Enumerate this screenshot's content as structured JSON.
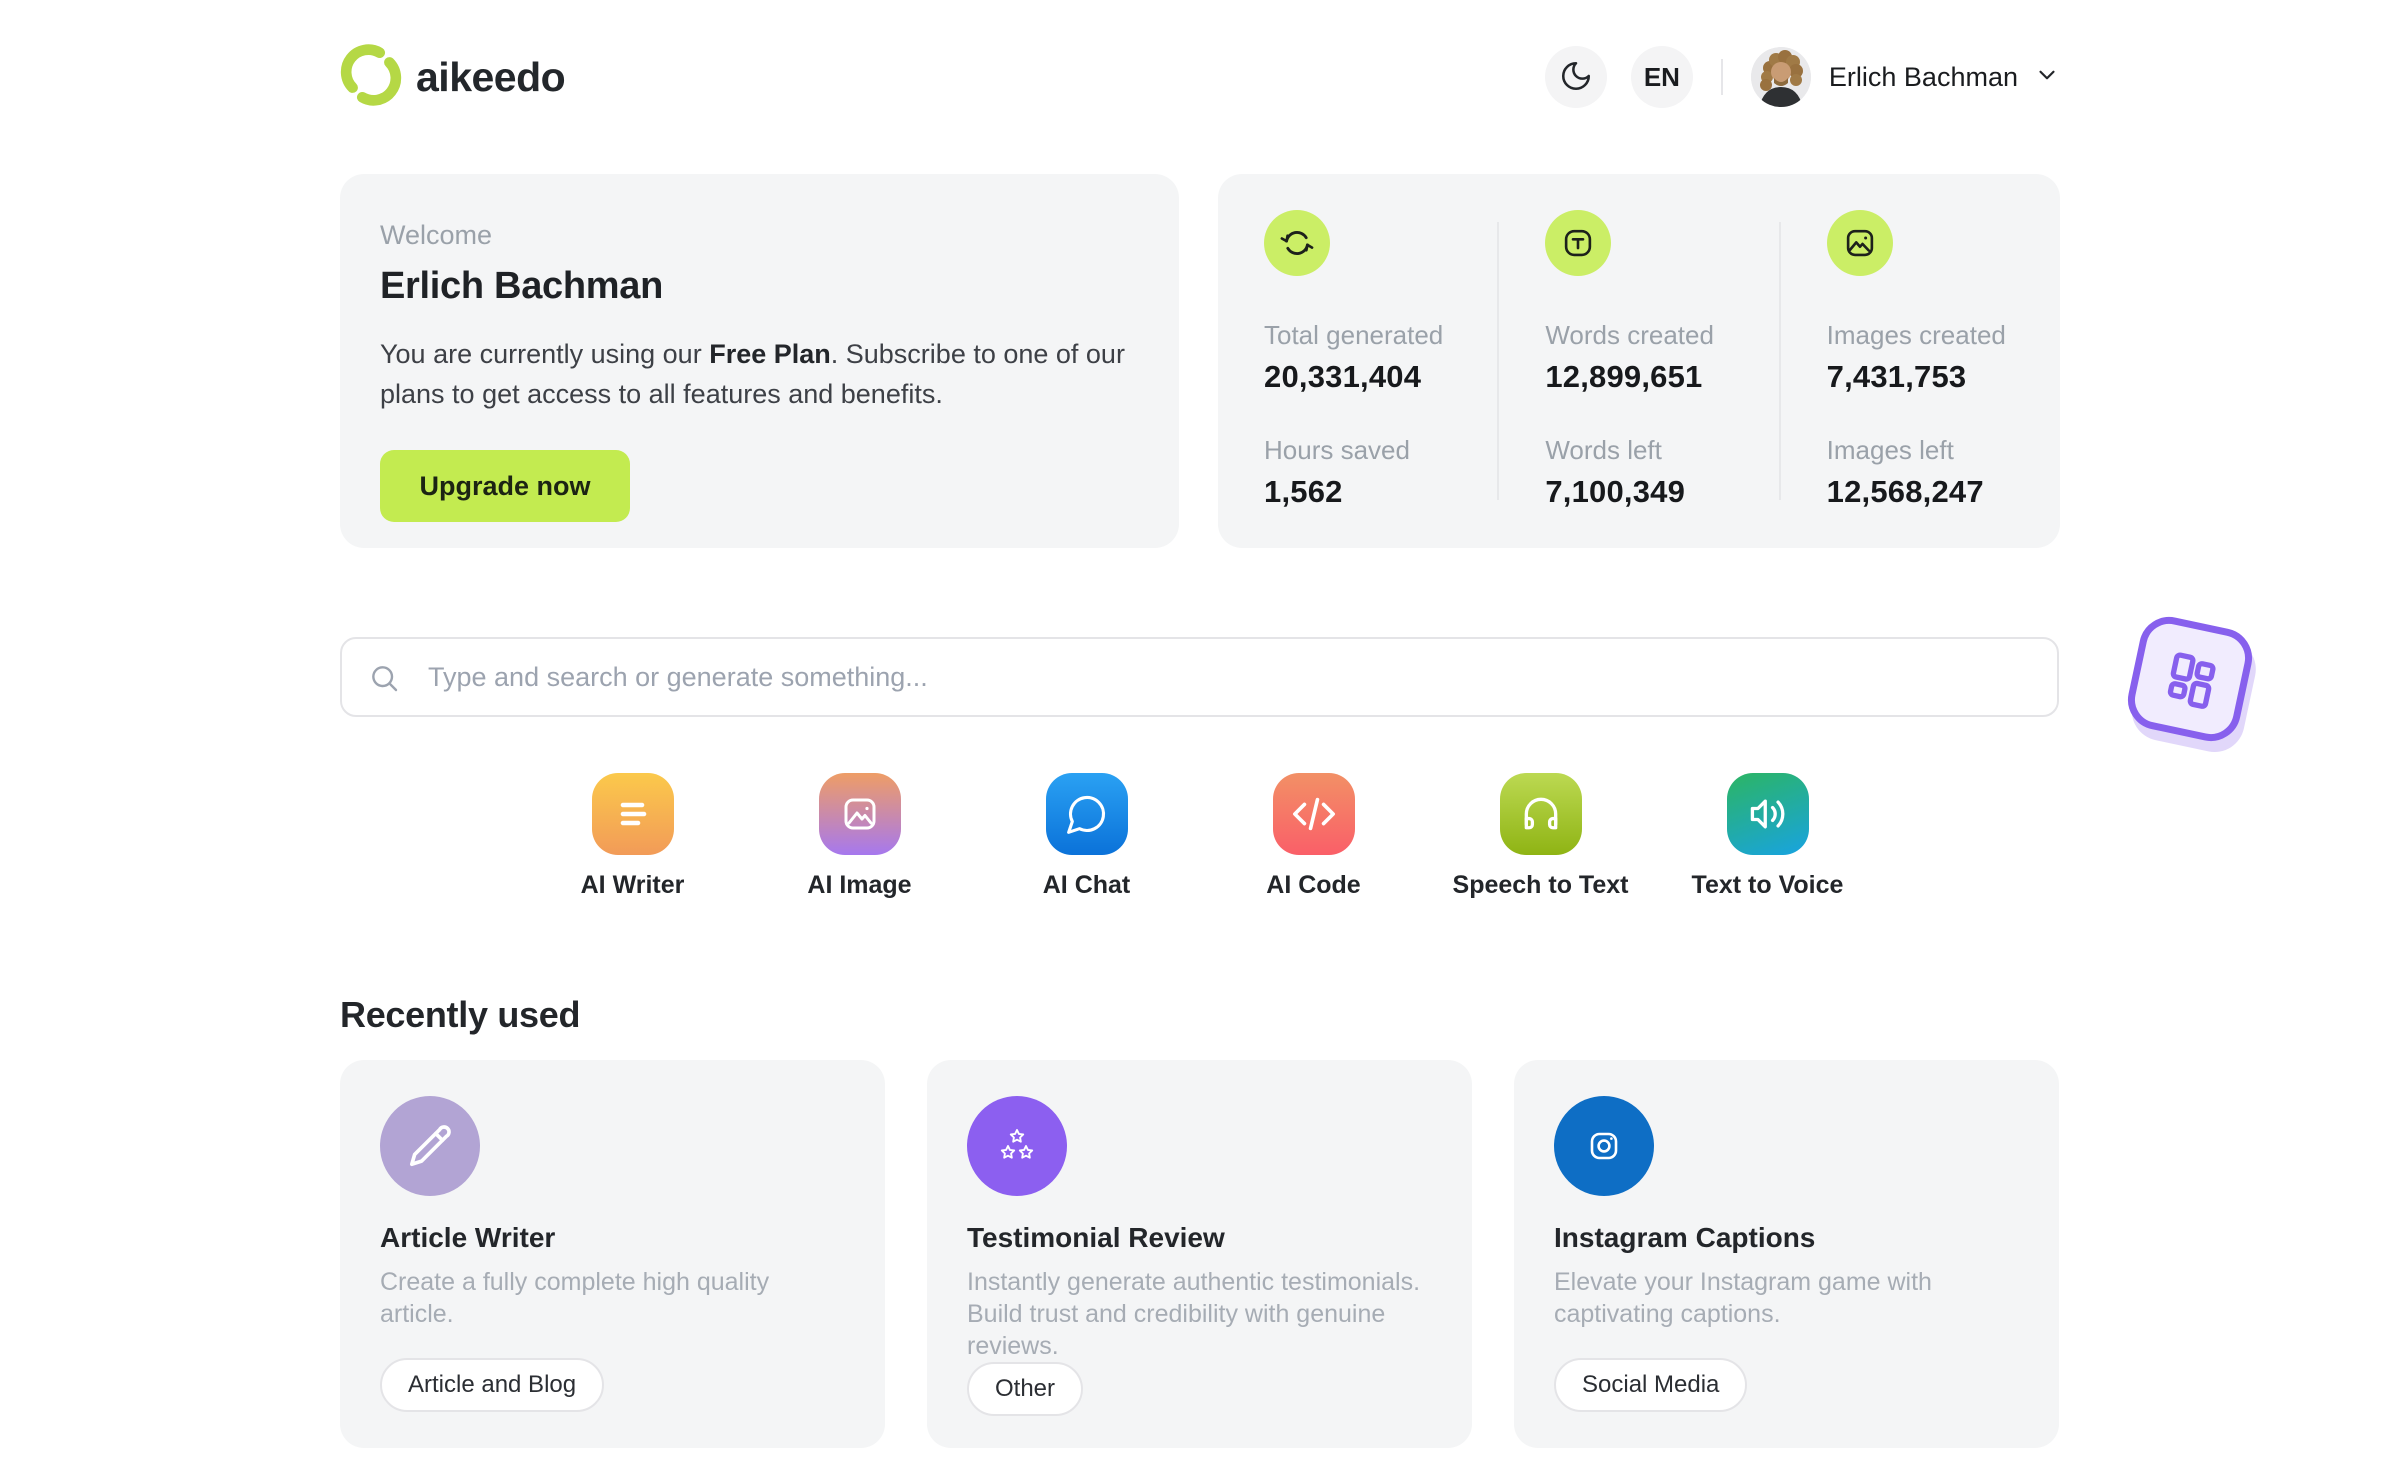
{
  "brand": {
    "name": "aikeedo"
  },
  "header": {
    "language": "EN",
    "user_name": "Erlich Bachman"
  },
  "welcome": {
    "eyebrow": "Welcome",
    "name": "Erlich Bachman",
    "message_before": "You are currently using our ",
    "message_bold": "Free Plan",
    "message_after": ". Subscribe to one of our plans to get access to all features and benefits.",
    "cta": "Upgrade now"
  },
  "stats": {
    "columns": [
      {
        "icon": "sync-icon",
        "items": [
          {
            "label": "Total generated",
            "value": "20,331,404"
          },
          {
            "label": "Hours saved",
            "value": "1,562"
          }
        ]
      },
      {
        "icon": "text-icon",
        "items": [
          {
            "label": "Words created",
            "value": "12,899,651"
          },
          {
            "label": "Words left",
            "value": "7,100,349"
          }
        ]
      },
      {
        "icon": "image-icon",
        "items": [
          {
            "label": "Images created",
            "value": "7,431,753"
          },
          {
            "label": "Images left",
            "value": "12,568,247"
          }
        ]
      }
    ]
  },
  "search": {
    "placeholder": "Type and search or generate something..."
  },
  "tools": [
    {
      "label": "AI Writer",
      "icon": "text-lines-icon"
    },
    {
      "label": "AI Image",
      "icon": "picture-icon"
    },
    {
      "label": "AI Chat",
      "icon": "chat-bubble-icon"
    },
    {
      "label": "AI Code",
      "icon": "code-icon"
    },
    {
      "label": "Speech to Text",
      "icon": "headphones-icon"
    },
    {
      "label": "Text to Voice",
      "icon": "speaker-icon"
    }
  ],
  "recent": {
    "heading": "Recently used",
    "cards": [
      {
        "title": "Article Writer",
        "description": "Create a fully complete high quality article.",
        "tag": "Article and Blog",
        "icon": "pencil-icon"
      },
      {
        "title": "Testimonial Review",
        "description": "Instantly generate authentic testimonials. Build trust and credibility with genuine reviews.",
        "tag": "Other",
        "icon": "stars-icon"
      },
      {
        "title": "Instagram Captions",
        "description": "Elevate your Instagram game with captivating captions.",
        "tag": "Social Media",
        "icon": "instagram-icon"
      }
    ]
  },
  "colors": {
    "lime_button": "#c3eb50",
    "lime_icon_circle": "#cbee66",
    "card_background": "#f4f5f6",
    "violet_accent": "#8760ed",
    "writer_circle": "#b2a4d4",
    "review_circle": "#8c5ff0",
    "instagram_circle": "#0e6ec5",
    "text_dark": "#1a1c1f",
    "text_gray": "#9aa1a9",
    "border": "#e4e4e7"
  }
}
